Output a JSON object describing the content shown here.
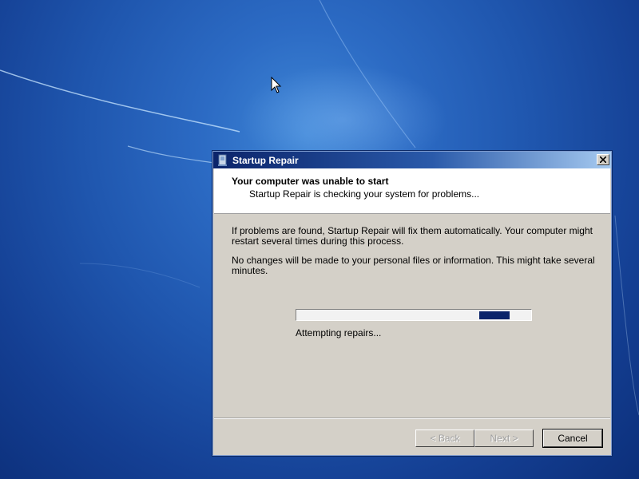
{
  "desktop": {
    "background_color": "#1f56ae"
  },
  "dialog": {
    "title": "Startup Repair",
    "title_icon": "startup-repair-icon",
    "close_icon": "close-icon",
    "header": {
      "title": "Your computer was unable to start",
      "subtitle": "Startup Repair is checking your system for problems..."
    },
    "body": {
      "paragraph1": "If problems are found, Startup Repair will fix them automatically. Your computer might restart several times during this process.",
      "paragraph2": "No changes will be made to your personal files or information. This might take several minutes."
    },
    "progress": {
      "state": "indeterminate",
      "status_text": "Attempting repairs..."
    },
    "buttons": {
      "back": "< Back",
      "next": "Next >",
      "cancel": "Cancel"
    }
  }
}
